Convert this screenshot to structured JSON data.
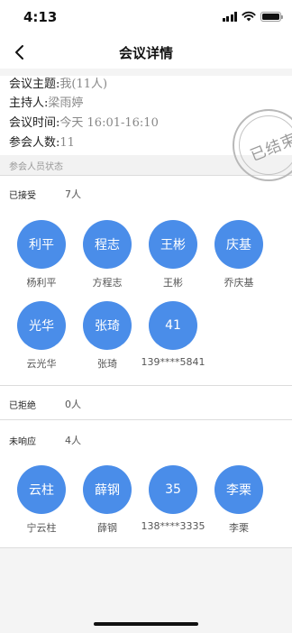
{
  "status_bar": {
    "time": "4:13"
  },
  "nav": {
    "title": "会议详情"
  },
  "info": {
    "topic_label": "会议主题:",
    "topic_value": "我(11人)",
    "host_label": "主持人:",
    "host_value": "梁雨婷",
    "time_label": "会议时间:",
    "time_value": "今天  16:01-16:10",
    "count_label": "参会人数:",
    "count_value": "11"
  },
  "stamp": {
    "text": "已结束"
  },
  "status_section": {
    "title": "参会人员状态"
  },
  "accepted": {
    "label": "已接受",
    "count": "7人",
    "members": [
      {
        "avatar": "利平",
        "name": "杨利平"
      },
      {
        "avatar": "程志",
        "name": "方程志"
      },
      {
        "avatar": "王彬",
        "name": "王彬"
      },
      {
        "avatar": "庆基",
        "name": "乔庆基"
      },
      {
        "avatar": "光华",
        "name": "云光华"
      },
      {
        "avatar": "张琦",
        "name": "张琦"
      },
      {
        "avatar": "41",
        "name": "139****5841"
      }
    ]
  },
  "rejected": {
    "label": "已拒绝",
    "count": "0人"
  },
  "no_response": {
    "label": "未响应",
    "count": "4人",
    "members": [
      {
        "avatar": "云柱",
        "name": "宁云柱"
      },
      {
        "avatar": "薛钢",
        "name": "薛钢"
      },
      {
        "avatar": "35",
        "name": "138****3335"
      },
      {
        "avatar": "李栗",
        "name": "李栗"
      }
    ]
  },
  "colors": {
    "avatar_bg": "#4a8de9",
    "page_bg": "#f4f4f4"
  }
}
